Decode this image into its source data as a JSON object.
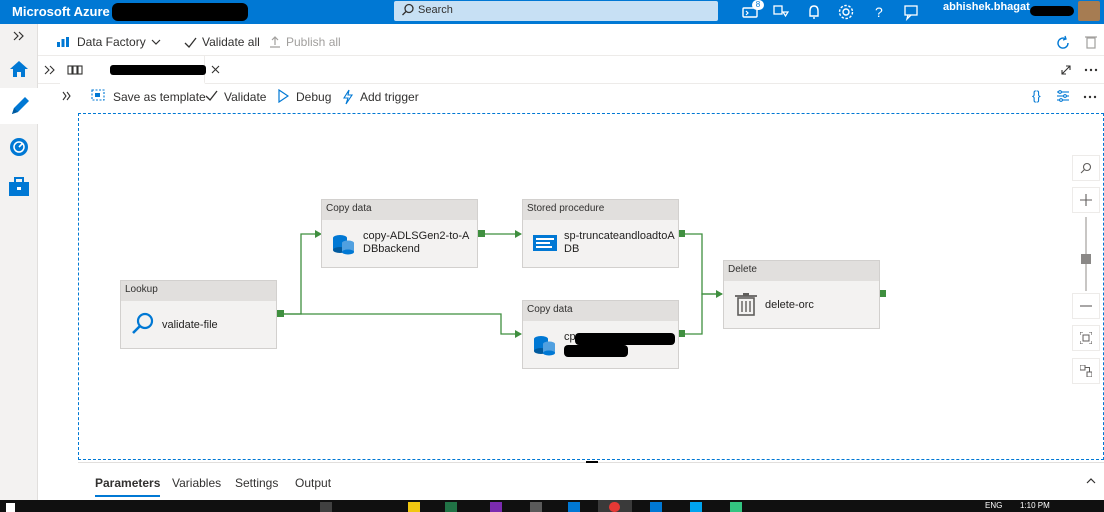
{
  "topbar": {
    "brand": "Microsoft Azure",
    "search_placeholder": "Search",
    "notification_count": "8",
    "user": "abhishek.bhagat"
  },
  "factory_toolbar": {
    "factory_label": "Data Factory",
    "validate_all": "Validate all",
    "publish_all": "Publish all"
  },
  "pipeline_toolbar": {
    "save_as_template": "Save as template",
    "validate": "Validate",
    "debug": "Debug",
    "add_trigger": "Add trigger",
    "code_glyph": "{}"
  },
  "activities": {
    "lookup": {
      "type": "Lookup",
      "name": "validate-file"
    },
    "copy1": {
      "type": "Copy data",
      "name": "copy-ADLSGen2-to-ADBbackend"
    },
    "stored_proc": {
      "type": "Stored procedure",
      "name": "sp-truncateandloadtoADB"
    },
    "copy2": {
      "type": "Copy data",
      "name": "cp"
    },
    "delete": {
      "type": "Delete",
      "name": "delete-orc"
    }
  },
  "bottom_panel": {
    "tabs": [
      "Parameters",
      "Variables",
      "Settings",
      "Output"
    ]
  },
  "taskbar": {
    "lang": "ENG",
    "time": "1:10 PM"
  },
  "colors": {
    "azure_blue": "#0078d4",
    "success_green": "#3f8f3f"
  }
}
